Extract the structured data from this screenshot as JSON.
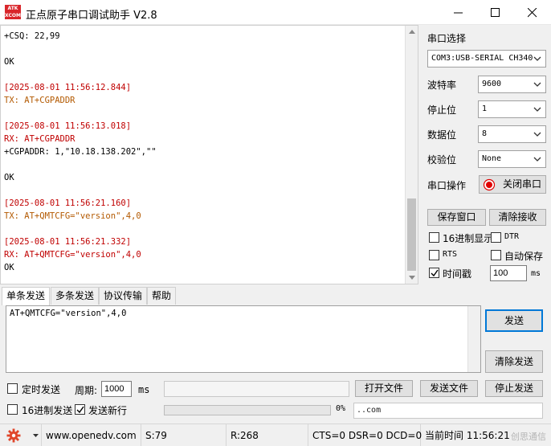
{
  "window": {
    "icon_text_top": "ATK",
    "icon_text_bottom": "XCOM",
    "title": "正点原子串口调试助手 V2.8"
  },
  "receive": {
    "lines": [
      {
        "text": "+CSQ: 22,99",
        "kind": "black"
      },
      {
        "text": "",
        "kind": "black"
      },
      {
        "text": "OK",
        "kind": "black"
      },
      {
        "text": "",
        "kind": "black"
      },
      {
        "text": "[2025-08-01 11:56:12.844]",
        "kind": "ts"
      },
      {
        "text": "TX: AT+CGPADDR",
        "kind": "tx"
      },
      {
        "text": "",
        "kind": "black"
      },
      {
        "text": "[2025-08-01 11:56:13.018]",
        "kind": "ts"
      },
      {
        "text": "RX: AT+CGPADDR",
        "kind": "rx"
      },
      {
        "text": "+CGPADDR: 1,\"10.18.138.202\",\"\"",
        "kind": "black"
      },
      {
        "text": "",
        "kind": "black"
      },
      {
        "text": "OK",
        "kind": "black"
      },
      {
        "text": "",
        "kind": "black"
      },
      {
        "text": "[2025-08-01 11:56:21.160]",
        "kind": "ts"
      },
      {
        "text": "TX: AT+QMTCFG=\"version\",4,0",
        "kind": "tx"
      },
      {
        "text": "",
        "kind": "black"
      },
      {
        "text": "[2025-08-01 11:56:21.332]",
        "kind": "ts"
      },
      {
        "text": "RX: AT+QMTCFG=\"version\",4,0",
        "kind": "rx"
      },
      {
        "text": "OK",
        "kind": "black"
      }
    ]
  },
  "serial": {
    "port_label": "串口选择",
    "port_value": "COM3:USB-SERIAL CH340",
    "baud_label": "波特率",
    "baud_value": "9600",
    "stop_label": "停止位",
    "stop_value": "1",
    "data_label": "数据位",
    "data_value": "8",
    "parity_label": "校验位",
    "parity_value": "None",
    "op_label": "串口操作",
    "op_button": "关闭串口"
  },
  "recv_options": {
    "save_window": "保存窗口",
    "clear_recv": "清除接收",
    "hex_display": "16进制显示",
    "dtr": "DTR",
    "rts": "RTS",
    "auto_save": "自动保存",
    "timestamp": "时间戳",
    "timestamp_value": "100",
    "ms": "ms"
  },
  "tabs": [
    "单条发送",
    "多条发送",
    "协议传输",
    "帮助"
  ],
  "send": {
    "text": "AT+QMTCFG=\"version\",4,0",
    "send_button": "发送",
    "clear_send": "清除发送",
    "timed_send": "定时发送",
    "period_label": "周期:",
    "period_value": "1000",
    "ms": "ms",
    "open_file": "打开文件",
    "send_file": "发送文件",
    "stop_send": "停止发送",
    "hex_send": "16进制发送",
    "send_newline": "发送新行",
    "progress_text": "0%",
    "progress": 0,
    "link_text": "..com"
  },
  "statusbar": {
    "url": "www.openedv.com",
    "sent": "S:79",
    "received": "R:268",
    "lines": "CTS=0 DSR=0 DCD=0",
    "time": "当前时间 11:56:21",
    "watermark": "创思通信"
  },
  "colors": {
    "timestamp": "#c00000",
    "tx": "#b35900",
    "accent": "#0078d7",
    "progress": "#06b025"
  }
}
